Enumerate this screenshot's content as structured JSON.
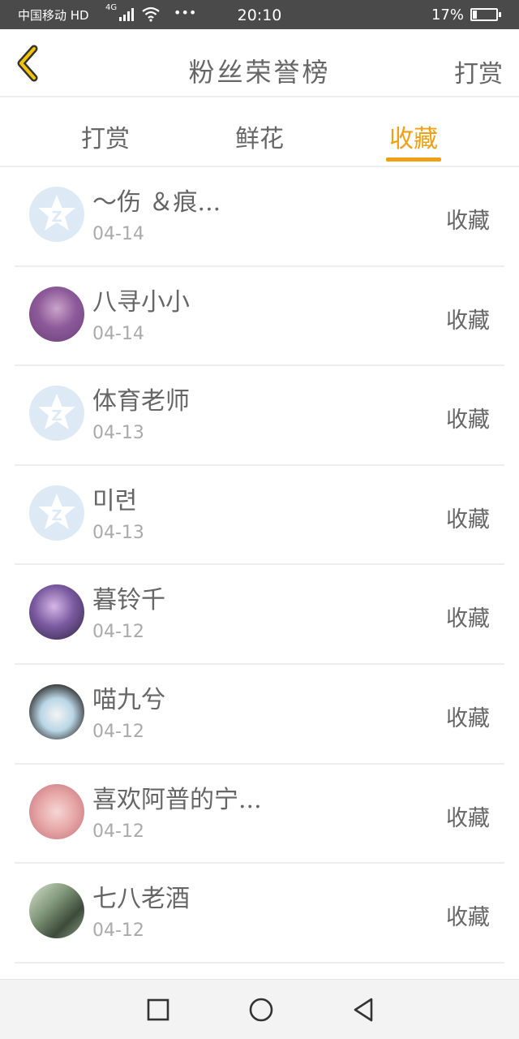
{
  "status_bar": {
    "carrier": "中国移动 HD",
    "network": "4G",
    "dots": "•••",
    "time": "20:10",
    "battery": "17%",
    "battery_level": 0.17
  },
  "header": {
    "title": "粉丝荣誉榜",
    "action_label": "打赏"
  },
  "tabs": [
    {
      "label": "打赏",
      "active": false
    },
    {
      "label": "鲜花",
      "active": false
    },
    {
      "label": "收藏",
      "active": true
    }
  ],
  "accent_color": "#f0a012",
  "list": [
    {
      "name": "～伤 ＆痕...",
      "date": "04-14",
      "action": "收藏",
      "avatar": "default-avatar-icon"
    },
    {
      "name": "八寻小小",
      "date": "04-14",
      "action": "收藏",
      "avatar": "user-photo"
    },
    {
      "name": "体育老师",
      "date": "04-13",
      "action": "收藏",
      "avatar": "default-avatar-icon"
    },
    {
      "name": "미련",
      "date": "04-13",
      "action": "收藏",
      "avatar": "default-avatar-icon"
    },
    {
      "name": "暮铃千",
      "date": "04-12",
      "action": "收藏",
      "avatar": "user-photo"
    },
    {
      "name": "喵九兮",
      "date": "04-12",
      "action": "收藏",
      "avatar": "user-photo"
    },
    {
      "name": "喜欢阿普的宁...",
      "date": "04-12",
      "action": "收藏",
      "avatar": "user-photo"
    },
    {
      "name": "七八老酒",
      "date": "04-12",
      "action": "收藏",
      "avatar": "user-photo"
    }
  ]
}
